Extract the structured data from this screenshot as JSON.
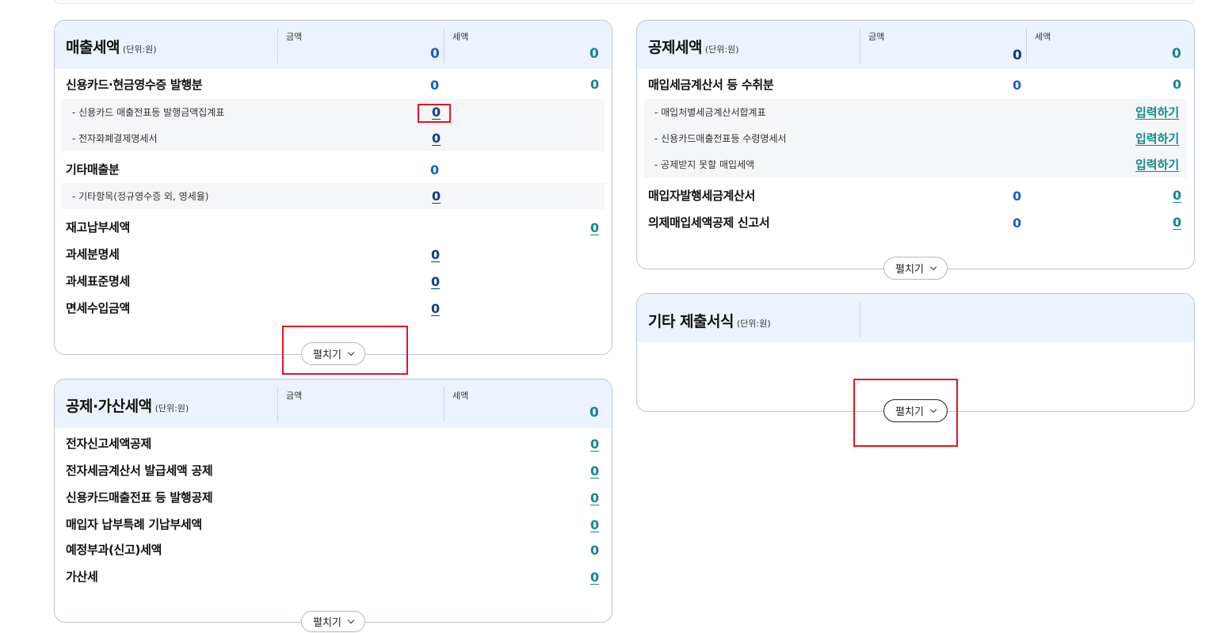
{
  "sales_tax": {
    "title": "매출세액",
    "unit": "(단위:원)",
    "col_amount": "금액",
    "col_tax": "세액",
    "total_amount": "0",
    "total_tax": "0",
    "rows": [
      {
        "label": "신용카드·현금영수증 발행분",
        "amount": "0",
        "tax": "0"
      },
      {
        "label": "- 신용카드 매출전표등 발행금액집계표",
        "amount": "0"
      },
      {
        "label": "- 전자화폐결제명세서",
        "amount": "0"
      },
      {
        "label": "기타매출분",
        "amount": "0"
      },
      {
        "label": "- 기타항목(정규영수증 외, 영세율)",
        "amount": "0"
      },
      {
        "label": "재고납부세액",
        "tax": "0"
      },
      {
        "label": "과세분명세",
        "amount": "0"
      },
      {
        "label": "과세표준명세",
        "amount": "0"
      },
      {
        "label": "면세수입금액",
        "amount": "0"
      }
    ],
    "expand_label": "펼치기"
  },
  "deduction_add_tax": {
    "title": "공제·가산세액",
    "unit": "(단위:원)",
    "col_amount": "금액",
    "col_tax": "세액",
    "total_tax": "0",
    "rows": [
      {
        "label": "전자신고세액공제",
        "tax": "0"
      },
      {
        "label": "전자세금계산서 발급세액 공제",
        "tax": "0"
      },
      {
        "label": "신용카드매출전표 등 발행공제",
        "tax": "0"
      },
      {
        "label": "매입자 납부특례 기납부세액",
        "tax": "0"
      },
      {
        "label": "예정부과(신고)세액",
        "tax": "0"
      },
      {
        "label": "가산세",
        "tax": "0"
      }
    ],
    "expand_label": "펼치기"
  },
  "deduction_tax": {
    "title": "공제세액",
    "unit": "(단위:원)",
    "col_amount": "금액",
    "col_tax": "세액",
    "total_amount": "0",
    "total_tax": "0",
    "rows": [
      {
        "label": "매입세금계산서 등 수취분",
        "amount": "0",
        "tax": "0"
      },
      {
        "label": "- 매입처별세금계산서합계표",
        "action": "입력하기"
      },
      {
        "label": "- 신용카드매출전표등 수령명세서",
        "action": "입력하기"
      },
      {
        "label": "- 공제받지 못할 매입세액",
        "action": "입력하기"
      },
      {
        "label": "매입자발행세금계산서",
        "amount": "0",
        "tax": "0"
      },
      {
        "label": "의제매입세액공제 신고서",
        "amount": "0",
        "tax": "0"
      }
    ],
    "expand_label": "펼치기"
  },
  "other_forms": {
    "title": "기타 제출서식",
    "unit": "(단위:원)",
    "expand_label": "펼치기"
  },
  "colors": {
    "blue": "#1b5fcb",
    "teal": "#14888a",
    "navy": "#0f3d89",
    "header_bg": "#edf3fe",
    "highlight": "#e5141e"
  }
}
